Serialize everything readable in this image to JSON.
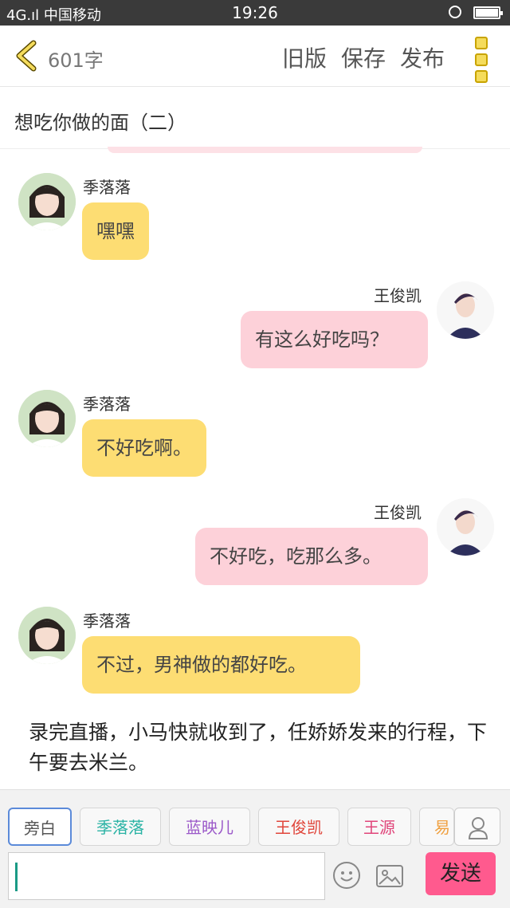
{
  "status": {
    "carrier": "4G.ıl 中国移动",
    "time": "19:26"
  },
  "topbar": {
    "word_count": "601字",
    "old_version": "旧版",
    "save": "保存",
    "publish": "发布"
  },
  "chapter_title": "想吃你做的面（二）",
  "messages": [
    {
      "speaker": "季落落",
      "text": "嘿嘿",
      "side": "left"
    },
    {
      "speaker": "王俊凯",
      "text": "有这么好吃吗？",
      "side": "right"
    },
    {
      "speaker": "季落落",
      "text": "不好吃啊。",
      "side": "left"
    },
    {
      "speaker": "王俊凯",
      "text": "不好吃，吃那么多。",
      "side": "right"
    },
    {
      "speaker": "季落落",
      "text": "不过，男神做的都好吃。",
      "side": "left"
    }
  ],
  "narration": "录完直播，小马快就收到了，任娇娇发来的行程，下午要去米兰。",
  "characters": [
    {
      "label": "旁白",
      "color": "#555555"
    },
    {
      "label": "季落落",
      "color": "#2bb3a5"
    },
    {
      "label": "蓝映儿",
      "color": "#9b59c9"
    },
    {
      "label": "王俊凯",
      "color": "#e0453a"
    },
    {
      "label": "王源",
      "color": "#e0457a"
    },
    {
      "label": "易",
      "color": "#f0a040"
    }
  ],
  "composer": {
    "send": "发送"
  },
  "colors": {
    "bubble_left": "#fddd73",
    "bubble_right": "#fdd1d9",
    "send_button": "#ff5a8e"
  }
}
